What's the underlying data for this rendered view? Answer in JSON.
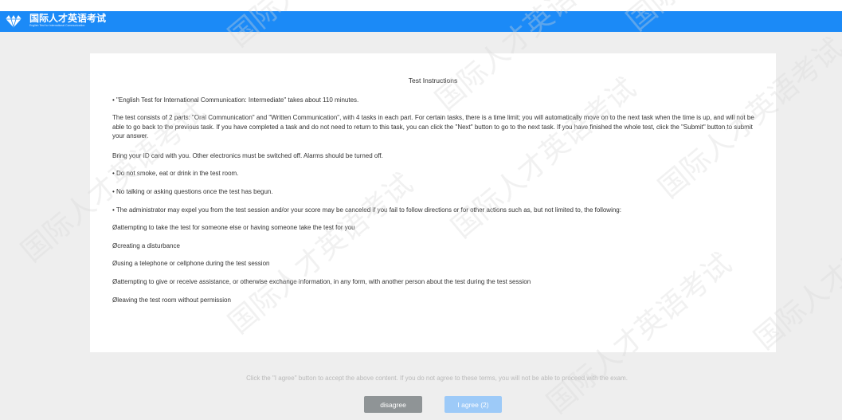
{
  "header": {
    "title": "国际人才英语考试",
    "subtitle": "English Test for International Communication",
    "bg_color": "#1b8af7"
  },
  "instructions": {
    "title": "Test Instructions",
    "lines": [
      "• \"English Test for International Communication: Intermediate\" takes about 110 minutes.",
      "  The test consists of 2 parts: \"Oral Communication\" and \"Written Communication\", with 4 tasks in each part. For certain tasks, there is a time limit; you will automatically move on to the next task when the time is up, and will not be able to go back to the previous task. If you have completed a task and do not need to return to this task, you can click the \"Next\" button to go to the next task. If you have finished the whole test, click the \"Submit\" button to submit your answer.",
      "  Bring your ID card with you. Other electronics must be switched off. Alarms should be turned off.",
      "• Do not smoke, eat or drink in the test room.",
      "• No talking or asking questions once the test has begun.",
      "• The administrator may expel you from the test session and/or your score may be canceled if you fail to follow directions or for other actions such as, but not limited to, the following:",
      "Øattempting to take the test for someone else or having someone take the test for you",
      "Øcreating a disturbance",
      "Øusing a telephone or cellphone during the test session",
      "Øattempting to give or receive assistance, or otherwise exchange information, in any form, with another person about the test during the test session",
      "Øleaving the test room without permission"
    ]
  },
  "footer": {
    "note": "Click the \"I agree\" button to accept the above content. If you do not agree to these terms, you will not be able to proceed with the exam.",
    "disagree_label": "disagree",
    "agree_label": "I agree (2)"
  },
  "watermark": {
    "text": "国际人才英语考试"
  },
  "colors": {
    "page_bg": "#eeeeee",
    "disagree_button": "#8f9496",
    "agree_button": "#9dcaf8"
  }
}
